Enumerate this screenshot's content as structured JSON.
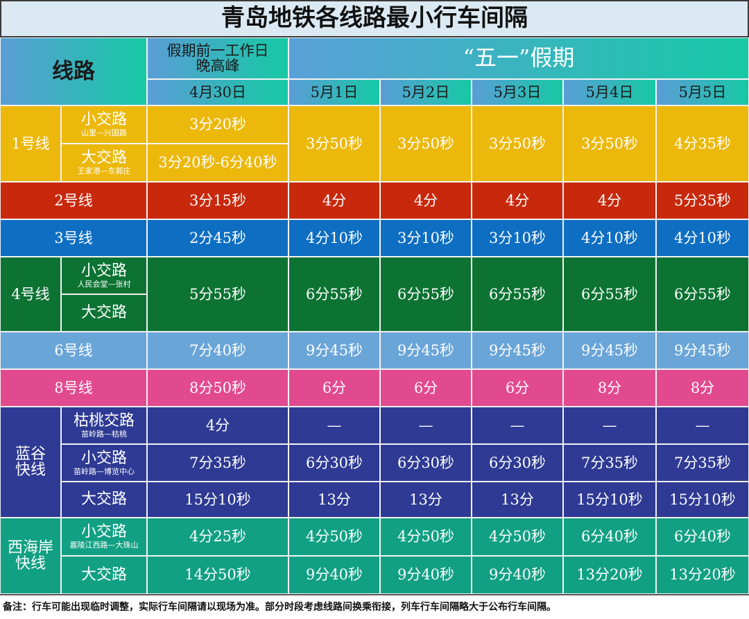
{
  "title": "青岛地铁各线路最小行车间隔",
  "header": {
    "route": "线路",
    "pre_holiday": "假期前一工作日\n晚高峰",
    "holiday": "“五一”假期",
    "dates": [
      "4月30日",
      "5月1日",
      "5月2日",
      "5月3日",
      "5月4日",
      "5月5日"
    ]
  },
  "line1": {
    "name": "1号线",
    "short": {
      "label": "小交路",
      "sub": "山里—兴国路",
      "pre": "3分20秒"
    },
    "long": {
      "label": "大交路",
      "sub": "王家港—东郭庄",
      "pre": "3分20秒-6分40秒"
    },
    "holiday": [
      "3分50秒",
      "3分50秒",
      "3分50秒",
      "3分50秒",
      "4分35秒"
    ]
  },
  "line2": {
    "name": "2号线",
    "values": [
      "3分15秒",
      "4分",
      "4分",
      "4分",
      "4分",
      "5分35秒"
    ]
  },
  "line3": {
    "name": "3号线",
    "values": [
      "2分45秒",
      "4分10秒",
      "3分10秒",
      "3分10秒",
      "4分10秒",
      "4分10秒"
    ]
  },
  "line4": {
    "name": "4号线",
    "short": {
      "label": "小交路",
      "sub": "人民会堂—张村"
    },
    "long": {
      "label": "大交路"
    },
    "values": [
      "5分55秒",
      "6分55秒",
      "6分55秒",
      "6分55秒",
      "6分55秒",
      "6分55秒"
    ]
  },
  "line6": {
    "name": "6号线",
    "values": [
      "7分40秒",
      "9分45秒",
      "9分45秒",
      "9分45秒",
      "9分45秒",
      "9分45秒"
    ]
  },
  "line8": {
    "name": "8号线",
    "values": [
      "8分50秒",
      "6分",
      "6分",
      "6分",
      "8分",
      "8分"
    ]
  },
  "langu": {
    "name": "蓝谷\n快线",
    "rows": [
      {
        "label": "枯桃交路",
        "sub": "苗岭路—枯桃",
        "values": [
          "4分",
          "—",
          "—",
          "—",
          "—",
          "—"
        ]
      },
      {
        "label": "小交路",
        "sub": "苗岭路—博览中心",
        "values": [
          "7分35秒",
          "6分30秒",
          "6分30秒",
          "6分30秒",
          "7分35秒",
          "7分35秒"
        ]
      },
      {
        "label": "大交路",
        "sub": "",
        "values": [
          "15分10秒",
          "13分",
          "13分",
          "13分",
          "15分10秒",
          "15分10秒"
        ]
      }
    ]
  },
  "xihaian": {
    "name": "西海岸\n快线",
    "rows": [
      {
        "label": "小交路",
        "sub": "嘉陵江西路—大珠山",
        "values": [
          "4分25秒",
          "4分50秒",
          "4分50秒",
          "4分50秒",
          "6分40秒",
          "6分40秒"
        ]
      },
      {
        "label": "大交路",
        "sub": "",
        "values": [
          "14分50秒",
          "9分40秒",
          "9分40秒",
          "9分40秒",
          "13分20秒",
          "13分20秒"
        ]
      }
    ]
  },
  "note": "备注：行车可能出现临时调整，实际行车间隔请以现场为准。部分时段考虑线路间换乘衔接，列车行车间隔略大于公布行车间隔。",
  "colors": {
    "line1": "#ecb80c",
    "line2": "#c8290d",
    "line3": "#0e6ec2",
    "line4": "#0d7333",
    "line6": "#6aa5d8",
    "line8": "#e24a8f",
    "langu": "#2e3a93",
    "xihaian": "#11a083"
  }
}
